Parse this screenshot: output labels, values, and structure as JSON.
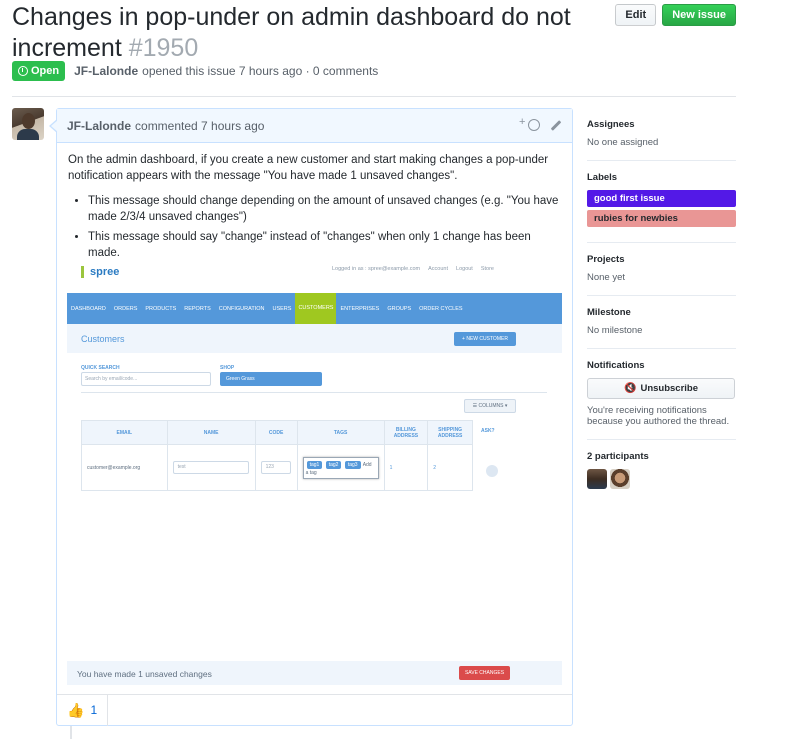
{
  "issue": {
    "title": "Changes in pop-under on admin dashboard do not increment",
    "number": "#1950",
    "state": "Open",
    "author": "JF-Lalonde",
    "opened_text": "opened this issue 7 hours ago · 0 comments"
  },
  "header_buttons": {
    "edit": "Edit",
    "new_issue": "New issue"
  },
  "comment": {
    "author": "JF-Lalonde",
    "time": "commented 7 hours ago",
    "body_p": "On the admin dashboard, if you create a new customer and start making changes a pop-under notification appears with the message \"You have made 1 unsaved changes\".",
    "bullets": [
      "This message should change depending on the amount of unsaved changes (e.g. \"You have made 2/3/4 unsaved changes\")",
      "This message should say \"change\" instead of \"changes\" when only 1 change has been made."
    ],
    "reaction_emoji": "👍",
    "reaction_count": "1"
  },
  "screenshot": {
    "logo": "spree",
    "toplinks": [
      "Logged in as : spree@example.com",
      "Account",
      "Logout",
      "Store"
    ],
    "nav": [
      "DASHBOARD",
      "ORDERS",
      "PRODUCTS",
      "REPORTS",
      "CONFIGURATION",
      "USERS",
      "CUSTOMERS",
      "ENTERPRISES",
      "GROUPS",
      "ORDER CYCLES"
    ],
    "page_title": "Customers",
    "new_customer": "+ NEW CUSTOMER",
    "quick_search_label": "QUICK SEARCH",
    "quick_search_placeholder": "Search by email/code...",
    "shop_label": "SHOP",
    "shop_value": "Green Grass",
    "columns_btn": "☰ COLUMNS ▾",
    "headers": [
      "EMAIL",
      "NAME",
      "CODE",
      "TAGS",
      "BILLING ADDRESS",
      "SHIPPING ADDRESS"
    ],
    "ask_label": "ASK?",
    "row": {
      "email": "customer@example.org",
      "name": "test",
      "code": "123",
      "tags": [
        "tag1",
        "tag2",
        "tag3"
      ],
      "add_tag": "Add a tag",
      "billing": "1",
      "shipping": "2"
    },
    "unsaved": "You have made 1 unsaved changes",
    "save_changes": "SAVE CHANGES"
  },
  "sidebar": {
    "assignees_title": "Assignees",
    "assignees_value": "No one assigned",
    "labels_title": "Labels",
    "labels": [
      {
        "name": "good first issue",
        "bg": "#5319e7",
        "fg": "#ffffff"
      },
      {
        "name": "rubies for newbies",
        "bg": "#e99695",
        "fg": "#24292e"
      }
    ],
    "projects_title": "Projects",
    "projects_value": "None yet",
    "milestone_title": "Milestone",
    "milestone_value": "No milestone",
    "notifications_title": "Notifications",
    "unsubscribe": "Unsubscribe",
    "notif_reason": "You're receiving notifications because you authored the thread.",
    "participants_title": "2 participants"
  }
}
